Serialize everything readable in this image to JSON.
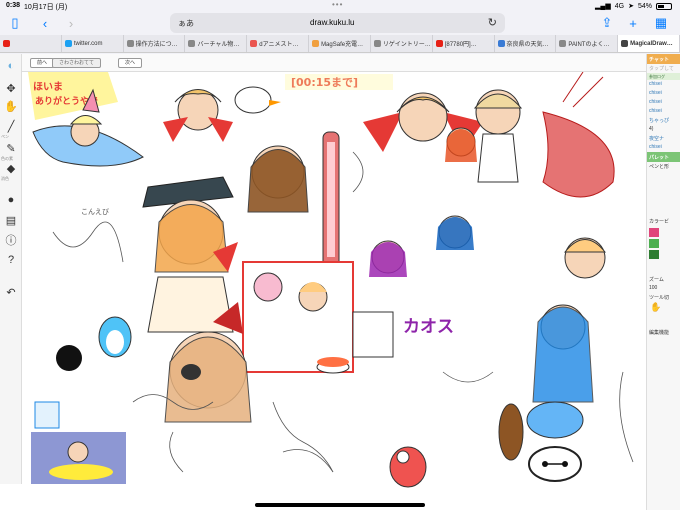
{
  "status": {
    "time": "0:38",
    "date": "10月17日 (月)",
    "network": "4G",
    "battery": "54%",
    "battery_level": 0.54
  },
  "nav": {
    "aa": "ぁあ",
    "host": "draw.kuku.lu"
  },
  "tabs": [
    {
      "label": "",
      "color": "#e62117"
    },
    {
      "label": "twitter.com",
      "color": "#1da1f2"
    },
    {
      "label": "操作方法につ…",
      "color": "#888888"
    },
    {
      "label": "バーチャル物…",
      "color": "#888888"
    },
    {
      "label": "dアニメスト…",
      "color": "#ea5550"
    },
    {
      "label": "MagSafe充電…",
      "color": "#f0a040"
    },
    {
      "label": "リゲイントリー…",
      "color": "#888888"
    },
    {
      "label": "[87780円]…",
      "color": "#e62117"
    },
    {
      "label": "奈良県の天気…",
      "color": "#3a7bd5"
    },
    {
      "label": "PAINTのよく…",
      "color": "#888888"
    },
    {
      "label": "MagicalDraw…",
      "color": "#444444"
    }
  ],
  "canvas": {
    "prev": "前へ",
    "mid": "さわさわおてて",
    "next": "次へ",
    "texts": {
      "thanks": "ほいま\nありがとうやで",
      "timer": "[00:15まで]",
      "chaos": "カオス",
      "konnichi": "こんえび"
    }
  },
  "tools": [
    "move-icon",
    "hand-icon",
    "pen-icon",
    "brush-icon",
    "fill-icon",
    "chat-icon",
    "layers-icon",
    "info-icon",
    "help-icon",
    "undo-icon"
  ],
  "tool_labels": {
    "pen": "ペン",
    "brush": "色の素",
    "fill": "消色"
  },
  "sidebar": {
    "chat_head": "チャット",
    "chat_tag": "タップして",
    "log_head": "参加ログ",
    "users": [
      "chisei",
      "chisei",
      "chisei",
      "chisei"
    ],
    "chabi": "ちゃっぴ",
    "chabi_n": "4)",
    "yozora": "夜空ナ",
    "chisei5": "chisei",
    "palette_head": "パレット",
    "pen_size": "ペンと形",
    "color_label": "カラービ",
    "zoom_label": "ズーム",
    "zoom": "100",
    "tool_label": "ツール切",
    "edit_label": "編集機能",
    "colors": [
      "#e0457b",
      "#4caf50",
      "#2e7d32"
    ]
  },
  "palette": {
    "skin": "#f6d5b8",
    "hair1": "#f3c46b",
    "hair2": "#b5651d",
    "red": "#e53935",
    "pink": "#f48fb1",
    "blue": "#64b5f6",
    "navy": "#3949ab",
    "purple": "#9c27b0",
    "ink": "#333333",
    "shrimp": "#e57373"
  }
}
